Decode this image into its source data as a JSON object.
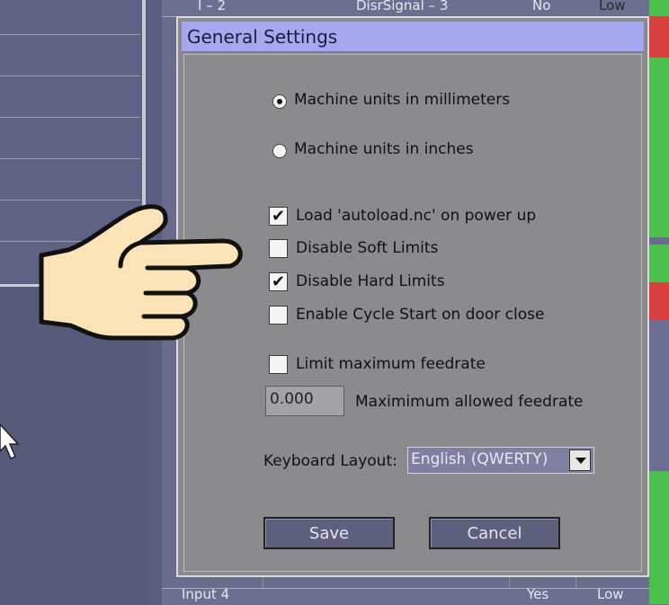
{
  "background": {
    "top_row": {
      "col1": "I – 2",
      "col2": "DisrSignal – 3",
      "col3": "No",
      "col4": "Low"
    },
    "bottom_row": {
      "col1": "Input 4",
      "col3": "Yes",
      "col4": "Low"
    }
  },
  "dialog": {
    "title": "General Settings",
    "units": {
      "mm_label": "Machine units in millimeters",
      "inch_label": "Machine units in inches",
      "selected": "mm"
    },
    "checkboxes": [
      {
        "label": "Load 'autoload.nc' on power up",
        "checked": true
      },
      {
        "label": "Disable Soft Limits",
        "checked": false
      },
      {
        "label": "Disable Hard Limits",
        "checked": true
      },
      {
        "label": "Enable Cycle Start on door close",
        "checked": false
      },
      {
        "label": "Limit maximum feedrate",
        "checked": false
      }
    ],
    "feedrate": {
      "value": "0.000",
      "label": "Maximimum allowed feedrate"
    },
    "keyboard": {
      "label": "Keyboard Layout:",
      "value": "English (QWERTY)"
    },
    "buttons": {
      "save": "Save",
      "cancel": "Cancel"
    }
  },
  "colors": {
    "title_bar": "#a6a8ef",
    "status_green": "#4cc04c",
    "status_red": "#d84040"
  },
  "icons": [
    "pointing-hand-icon",
    "mouse-cursor-icon",
    "dropdown-arrow-icon"
  ]
}
